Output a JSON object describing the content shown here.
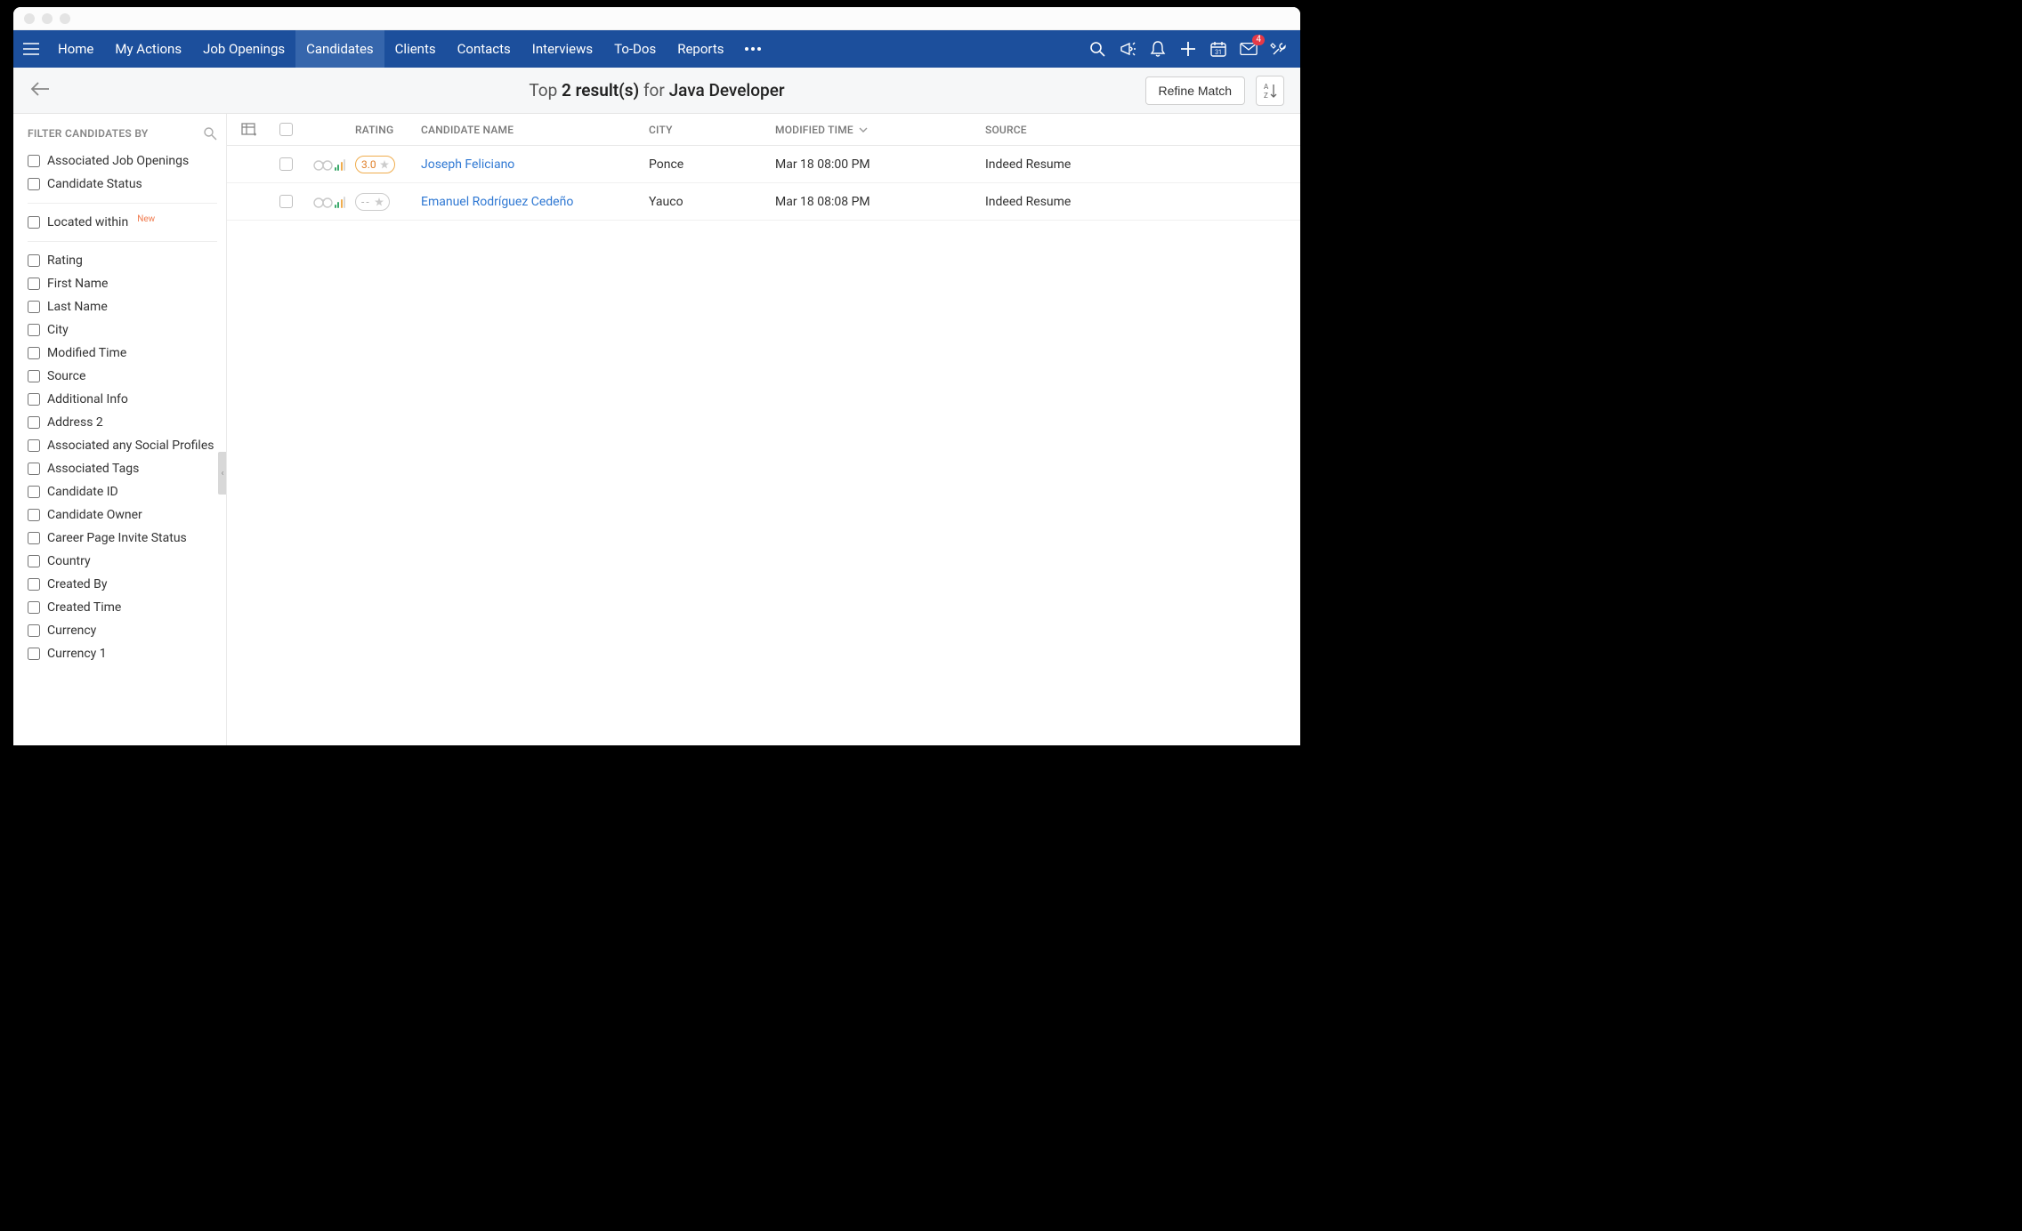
{
  "nav": {
    "items": [
      "Home",
      "My Actions",
      "Job Openings",
      "Candidates",
      "Clients",
      "Contacts",
      "Interviews",
      "To-Dos",
      "Reports"
    ],
    "activeIndex": 3,
    "mailBadge": "4"
  },
  "subheader": {
    "prefix": "Top",
    "count": "2 result(s)",
    "for": "for",
    "job": "Java Developer",
    "refine": "Refine Match"
  },
  "sidebar": {
    "title": "FILTER CANDIDATES BY",
    "group1": [
      "Associated Job Openings",
      "Candidate Status"
    ],
    "located": "Located within",
    "locatedBadge": "New",
    "group2": [
      "Rating",
      "First Name",
      "Last Name",
      "City",
      "Modified Time",
      "Source",
      "Additional Info",
      "Address 2",
      "Associated any Social Profiles",
      "Associated Tags",
      "Candidate ID",
      "Candidate Owner",
      "Career Page Invite Status",
      "Country",
      "Created By",
      "Created Time",
      "Currency",
      "Currency 1"
    ]
  },
  "table": {
    "headers": {
      "rating": "RATING",
      "name": "CANDIDATE NAME",
      "city": "CITY",
      "mtime": "MODIFIED TIME",
      "source": "SOURCE"
    },
    "rows": [
      {
        "rating": "3.0",
        "ratingStyle": "orange",
        "name": "Joseph Feliciano",
        "city": "Ponce",
        "mtime": "Mar 18 08:00 PM",
        "source": "Indeed Resume"
      },
      {
        "rating": "--",
        "ratingStyle": "gray",
        "name": "Emanuel Rodríguez Cedeño",
        "city": "Yauco",
        "mtime": "Mar 18 08:08 PM",
        "source": "Indeed Resume"
      }
    ]
  }
}
